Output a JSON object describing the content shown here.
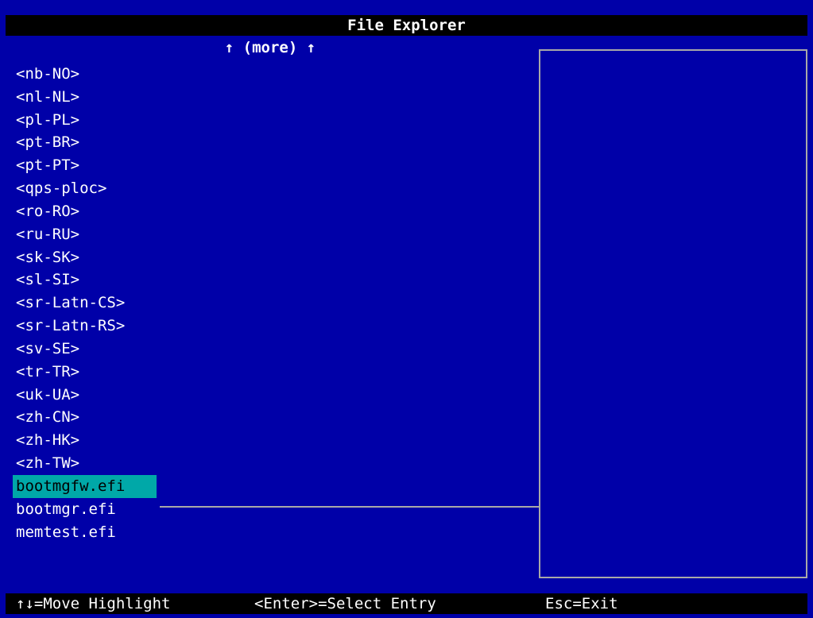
{
  "window": {
    "title": "File Explorer"
  },
  "list": {
    "more_indicator": "↑ (more) ↑",
    "entries": [
      {
        "label": "<nb-NO>",
        "kind": "dir"
      },
      {
        "label": "<nl-NL>",
        "kind": "dir"
      },
      {
        "label": "<pl-PL>",
        "kind": "dir"
      },
      {
        "label": "<pt-BR>",
        "kind": "dir"
      },
      {
        "label": "<pt-PT>",
        "kind": "dir"
      },
      {
        "label": "<qps-ploc>",
        "kind": "dir"
      },
      {
        "label": "<ro-RO>",
        "kind": "dir"
      },
      {
        "label": "<ru-RU>",
        "kind": "dir"
      },
      {
        "label": "<sk-SK>",
        "kind": "dir"
      },
      {
        "label": "<sl-SI>",
        "kind": "dir"
      },
      {
        "label": "<sr-Latn-CS>",
        "kind": "dir"
      },
      {
        "label": "<sr-Latn-RS>",
        "kind": "dir"
      },
      {
        "label": "<sv-SE>",
        "kind": "dir"
      },
      {
        "label": "<tr-TR>",
        "kind": "dir"
      },
      {
        "label": "<uk-UA>",
        "kind": "dir"
      },
      {
        "label": "<zh-CN>",
        "kind": "dir"
      },
      {
        "label": "<zh-HK>",
        "kind": "dir"
      },
      {
        "label": "<zh-TW>",
        "kind": "dir"
      },
      {
        "label": "bootmgfw.efi",
        "kind": "file",
        "selected": true
      },
      {
        "label": "bootmgr.efi",
        "kind": "file"
      },
      {
        "label": "memtest.efi",
        "kind": "file"
      }
    ]
  },
  "status_bar": {
    "move_hint": "↑↓=Move Highlight",
    "select_hint": "<Enter>=Select Entry",
    "exit_hint": "Esc=Exit"
  },
  "colors": {
    "background": "#0000a8",
    "bar": "#000000",
    "highlight": "#00a8a8",
    "text": "#ffffff",
    "border": "#a8a8a8"
  }
}
